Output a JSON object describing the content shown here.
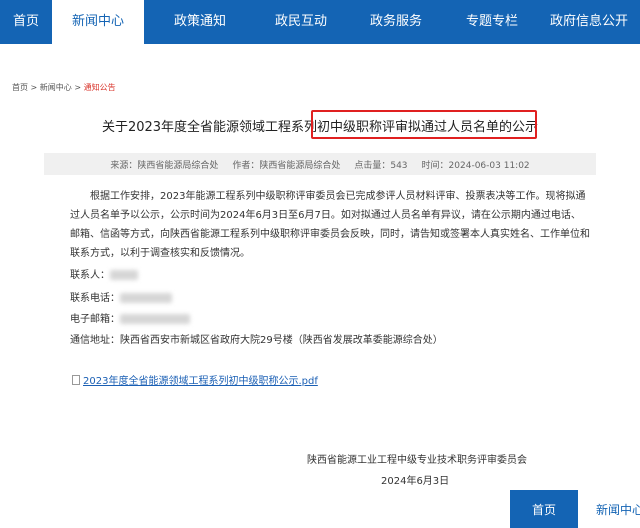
{
  "nav": {
    "items": [
      {
        "label": "首页",
        "active": false
      },
      {
        "label": "新闻中心",
        "active": true
      },
      {
        "label": "政策通知",
        "active": false
      },
      {
        "label": "政民互动",
        "active": false
      },
      {
        "label": "政务服务",
        "active": false
      },
      {
        "label": "专题专栏",
        "active": false
      },
      {
        "label": "政府信息公开",
        "active": false
      }
    ]
  },
  "breadcrumb": {
    "home": "首页",
    "sep1": " > ",
    "section": "新闻中心",
    "sep2": " > ",
    "current": "通知公告"
  },
  "article": {
    "title": "关于2023年度全省能源领域工程系列初中级职称评审拟通过人员名单的公示",
    "meta": {
      "source": "来源：陕西省能源局综合处",
      "author": "作者：陕西省能源局综合处",
      "views": "点击量：543",
      "time": "时间：2024-06-03 11:02"
    },
    "para1": "根据工作安排，2023年能源工程系列中级职称评审委员会已完成参评人员材料评审、投票表决等工作。现将拟通过人员名单予以公示，公示时间为2024年6月3日至6月7日。如对拟通过人员名单有异议，请在公示期内通过电话、邮箱、信函等方式，向陕西省能源工程系列中级职称评审委员会反映，同时，请告知或签署本人真实姓名、工作单位和联系方式，以利于调查核实和反馈情况。",
    "contact_label": "联系人：",
    "phone_label": "联系电话：",
    "email_label": "电子邮箱：",
    "address": "通信地址：陕西省西安市新城区省政府大院29号楼（陕西省发展改革委能源综合处）",
    "attachment": "2023年度全省能源领域工程系列初中级职称公示.pdf",
    "signature": "陕西省能源工业工程中级专业技术职务评审委员会",
    "date": "2024年6月3日"
  },
  "float_nav": {
    "home": "首页",
    "news": "新闻中心"
  },
  "colors": {
    "nav_bg": "#1464b4",
    "highlight": "#e02020",
    "breadcrumb_current": "#d9342b",
    "link": "#1a5fb4"
  }
}
